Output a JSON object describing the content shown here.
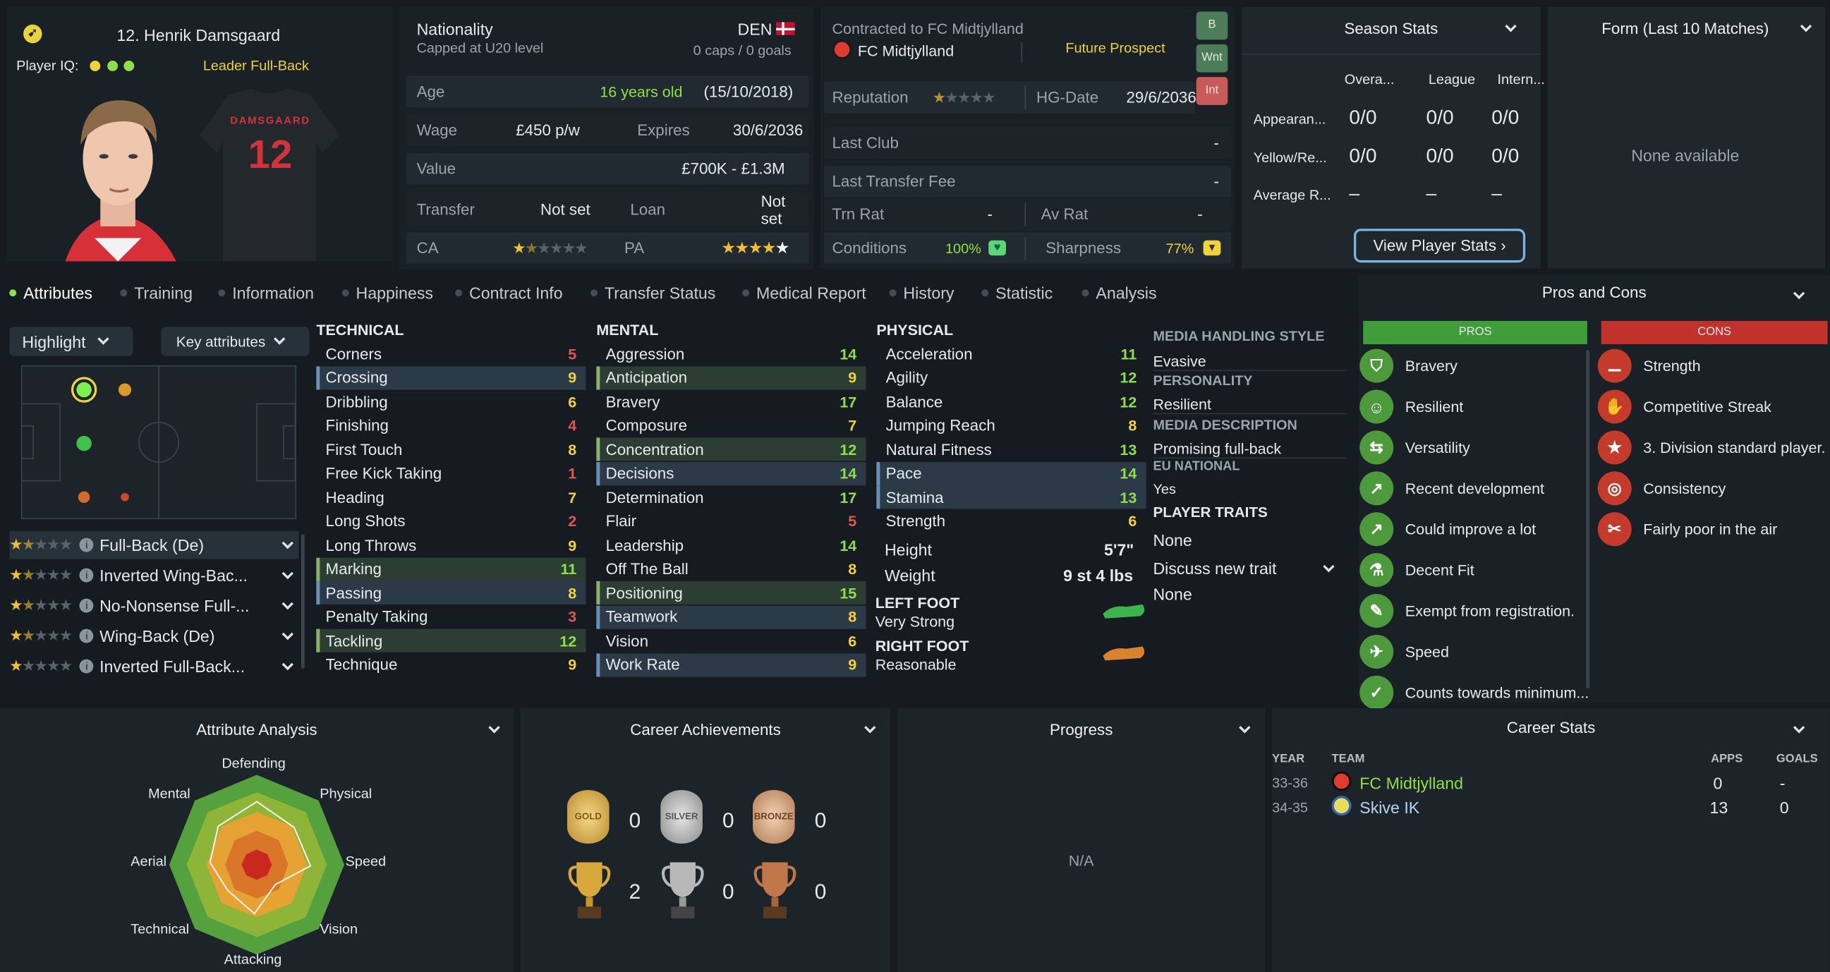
{
  "player": {
    "name": "12. Henrik Damsgaard",
    "iq_label": "Player IQ:",
    "role_label": "Leader Full-Back",
    "shirt_name": "DAMSGAARD",
    "shirt_number": "12"
  },
  "nationality": {
    "label": "Nationality",
    "sub": "Capped at U20 level",
    "code": "DEN",
    "caps": "0 caps / 0 goals"
  },
  "info": {
    "age_label": "Age",
    "age": "16 years old",
    "dob": "(15/10/2018)",
    "wage_label": "Wage",
    "wage": "£450 p/w",
    "expires_label": "Expires",
    "expires": "30/6/2036",
    "value_label": "Value",
    "value": "£700K - £1.3M",
    "transfer_label": "Transfer",
    "transfer": "Not set",
    "loan_label": "Loan",
    "loan": "Not set",
    "ca_label": "CA",
    "pa_label": "PA"
  },
  "contract": {
    "label": "Contracted to FC Midtjylland",
    "club": "FC Midtjylland",
    "status": "Future Prospect",
    "rep_label": "Reputation",
    "hg_label": "HG-Date",
    "hg": "29/6/2036",
    "last_club_label": "Last Club",
    "last_club": "-",
    "last_fee_label": "Last Transfer Fee",
    "last_fee": "-",
    "trn_label": "Trn Rat",
    "trn": "-",
    "av_label": "Av Rat",
    "av": "-",
    "cond_label": "Conditions",
    "cond": "100%",
    "sharp_label": "Sharpness",
    "sharp": "77%",
    "squad_b": "B",
    "squad_wnt": "Wnt",
    "squad_int": "Int"
  },
  "season": {
    "title": "Season Stats",
    "cols": [
      "Overa...",
      "League",
      "Intern..."
    ],
    "rows": [
      {
        "label": "Appearan...",
        "vals": [
          "0/0",
          "0/0",
          "0/0"
        ]
      },
      {
        "label": "Yellow/Re...",
        "vals": [
          "0/0",
          "0/0",
          "0/0"
        ]
      },
      {
        "label": "Average R...",
        "vals": [
          "–",
          "–",
          "–"
        ]
      }
    ],
    "button": "View Player Stats ›"
  },
  "form": {
    "title": "Form (Last 10 Matches)",
    "empty": "None available"
  },
  "tabs": [
    "Attributes",
    "Training",
    "Information",
    "Happiness",
    "Contract Info",
    "Transfer Status",
    "Medical Report",
    "History",
    "Statistic",
    "Analysis"
  ],
  "controls": {
    "highlight": "Highlight",
    "key": "Key attributes"
  },
  "roles": [
    {
      "label": "Full-Back (De)",
      "stars": 1.5
    },
    {
      "label": "Inverted Wing-Bac...",
      "stars": 1.5
    },
    {
      "label": "No-Nonsense Full-...",
      "stars": 1.5
    },
    {
      "label": "Wing-Back (De)",
      "stars": 1.5
    },
    {
      "label": "Inverted Full-Back...",
      "stars": 1
    }
  ],
  "technical": {
    "title": "TECHNICAL",
    "items": [
      [
        "Corners",
        "5"
      ],
      [
        "Crossing",
        "9"
      ],
      [
        "Dribbling",
        "6"
      ],
      [
        "Finishing",
        "4"
      ],
      [
        "First Touch",
        "8"
      ],
      [
        "Free Kick Taking",
        "1"
      ],
      [
        "Heading",
        "7"
      ],
      [
        "Long Shots",
        "2"
      ],
      [
        "Long Throws",
        "9"
      ],
      [
        "Marking",
        "11"
      ],
      [
        "Passing",
        "8"
      ],
      [
        "Penalty Taking",
        "3"
      ],
      [
        "Tackling",
        "12"
      ],
      [
        "Technique",
        "9"
      ]
    ]
  },
  "mental": {
    "title": "MENTAL",
    "items": [
      [
        "Aggression",
        "14"
      ],
      [
        "Anticipation",
        "9"
      ],
      [
        "Bravery",
        "17"
      ],
      [
        "Composure",
        "7"
      ],
      [
        "Concentration",
        "12"
      ],
      [
        "Decisions",
        "14"
      ],
      [
        "Determination",
        "17"
      ],
      [
        "Flair",
        "5"
      ],
      [
        "Leadership",
        "14"
      ],
      [
        "Off The Ball",
        "8"
      ],
      [
        "Positioning",
        "15"
      ],
      [
        "Teamwork",
        "8"
      ],
      [
        "Vision",
        "6"
      ],
      [
        "Work Rate",
        "9"
      ]
    ]
  },
  "physical": {
    "title": "PHYSICAL",
    "items": [
      [
        "Acceleration",
        "11"
      ],
      [
        "Agility",
        "12"
      ],
      [
        "Balance",
        "12"
      ],
      [
        "Jumping Reach",
        "8"
      ],
      [
        "Natural Fitness",
        "13"
      ],
      [
        "Pace",
        "14"
      ],
      [
        "Stamina",
        "13"
      ],
      [
        "Strength",
        "6"
      ]
    ],
    "height_label": "Height",
    "height": "5'7\"",
    "weight_label": "Weight",
    "weight": "9 st 4 lbs",
    "left_label": "LEFT FOOT",
    "left": "Very Strong",
    "right_label": "RIGHT FOOT",
    "right": "Reasonable"
  },
  "media": {
    "style_label": "MEDIA HANDLING STYLE",
    "style": "Evasive",
    "pers_label": "PERSONALITY",
    "pers": "Resilient",
    "desc_label": "MEDIA DESCRIPTION",
    "desc": "Promising full-back",
    "eu_label": "EU NATIONAL",
    "eu": "Yes",
    "traits_label": "PLAYER TRAITS",
    "traits": "None",
    "discuss": "Discuss new trait",
    "discuss_val": "None"
  },
  "pros_cons": {
    "title": "Pros and Cons",
    "pros_label": "PROS",
    "cons_label": "CONS",
    "pros": [
      "Bravery",
      "Resilient",
      "Versatility",
      "Recent development",
      "Could improve a lot",
      "Decent Fit",
      "Exempt from registration.",
      "Speed",
      "Counts towards minimum..."
    ],
    "cons": [
      "Strength",
      "Competitive Streak",
      "3. Division standard player.",
      "Consistency",
      "Fairly poor in the air"
    ]
  },
  "analysis": {
    "title": "Attribute Analysis",
    "labels": {
      "defending": "Defending",
      "physical": "Physical",
      "speed": "Speed",
      "vision": "Vision",
      "attacking": "Attacking",
      "technical": "Technical",
      "aerial": "Aerial",
      "mental": "Mental"
    }
  },
  "achievements": {
    "title": "Career Achievements",
    "gold": "GOLD",
    "silver": "SILVER",
    "bronze": "BRONZE",
    "counts": [
      "0",
      "0",
      "0",
      "2",
      "0",
      "0"
    ]
  },
  "progress": {
    "title": "Progress",
    "empty": "N/A"
  },
  "career": {
    "title": "Career Stats",
    "cols": [
      "YEAR",
      "TEAM",
      "APPS",
      "GOALS"
    ],
    "rows": [
      {
        "year": "33-36",
        "team": "FC Midtjylland",
        "apps": "0",
        "goals": "-"
      },
      {
        "year": "34-35",
        "team": "Skive IK",
        "apps": "13",
        "goals": "0"
      }
    ]
  },
  "colors": {
    "pros": "#3f9e3a",
    "cons": "#c0322b",
    "accent": "#8ee04a"
  }
}
